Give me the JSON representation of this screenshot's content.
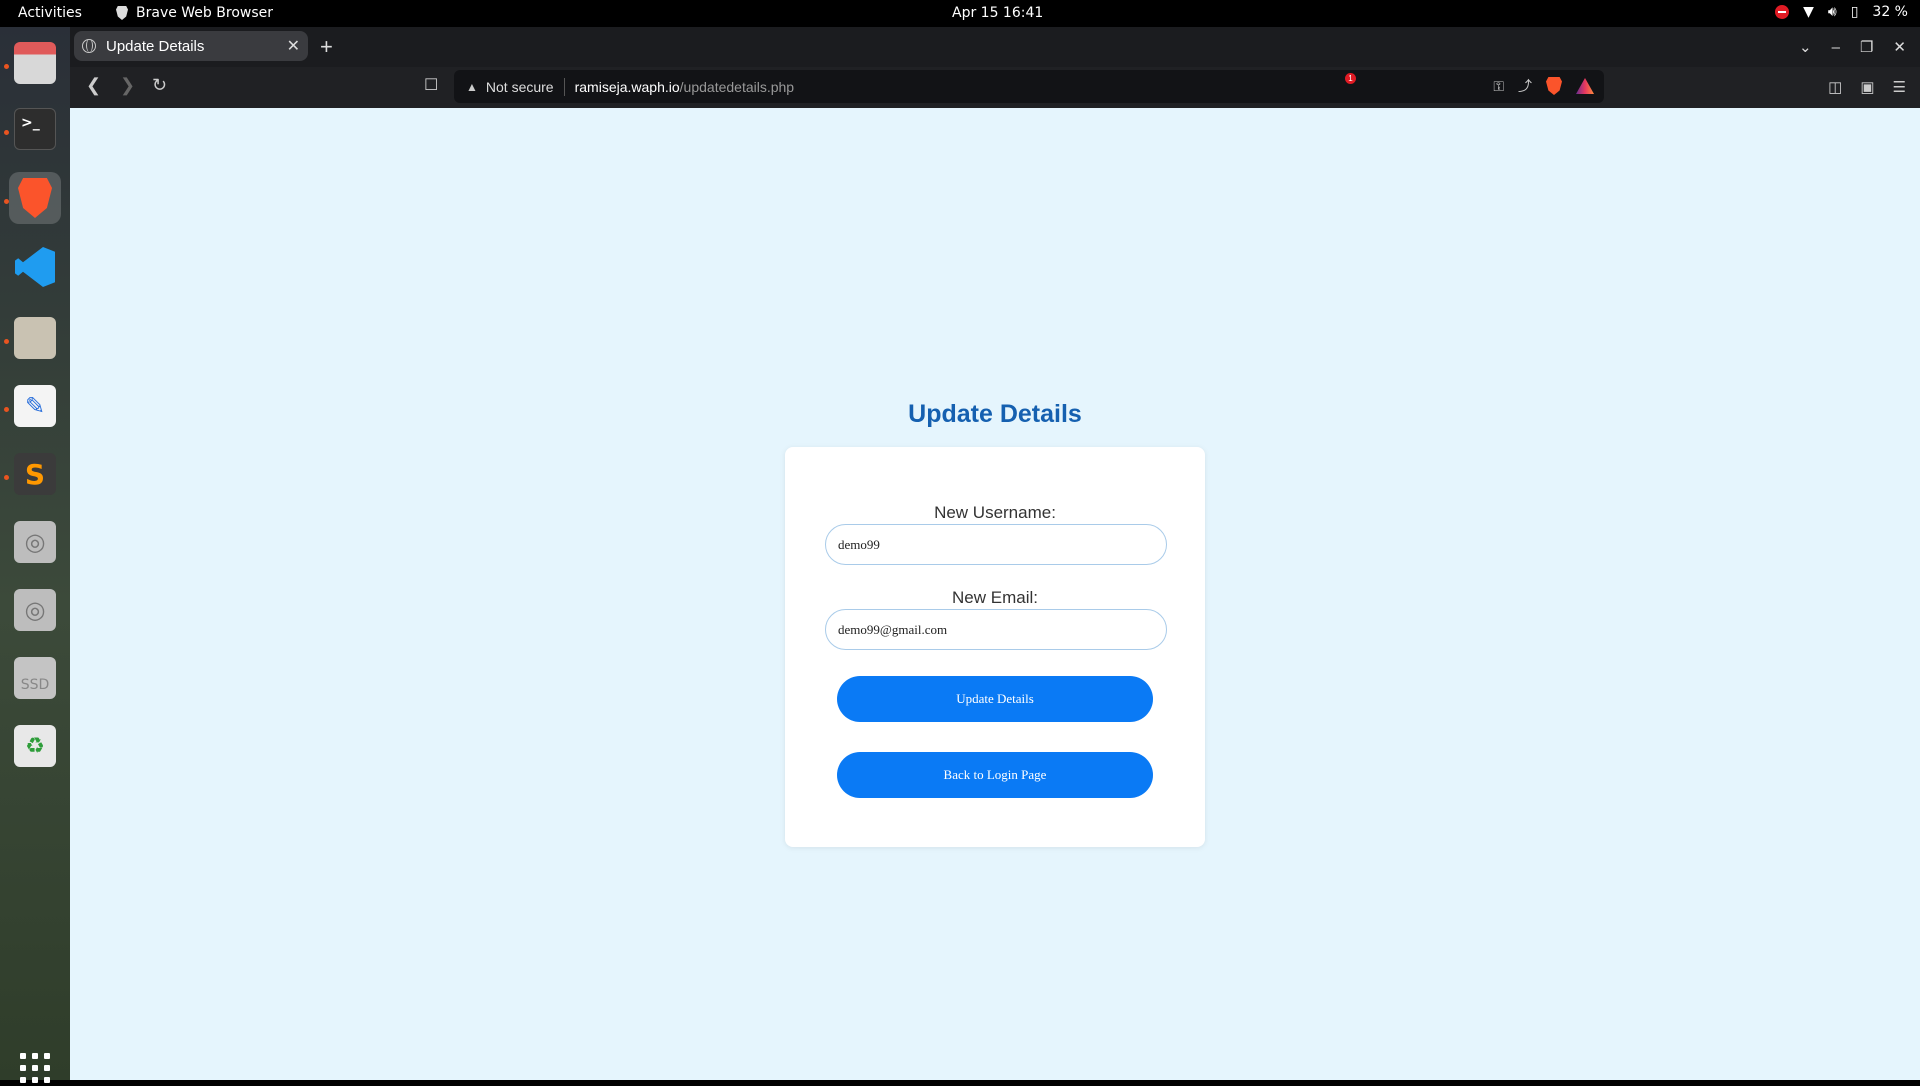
{
  "system": {
    "activities": "Activities",
    "app_name": "Brave Web Browser",
    "clock": "Apr 15  16:41",
    "battery": "32 %"
  },
  "browser": {
    "tab_title": "Update Details",
    "url_warning": "Not secure",
    "url_host": "ramiseja.waph.io",
    "url_path": "/updatedetails.php",
    "rewards_badge": "1"
  },
  "form": {
    "heading": "Update Details",
    "username_label": "New Username:",
    "username_value": "demo99",
    "email_label": "New Email:",
    "email_value": "demo99@gmail.com",
    "update_button": "Update Details",
    "back_button": "Back to Login Page"
  },
  "colors": {
    "page_background": "#e5f5fd",
    "heading": "#1560b0",
    "button": "#0a7af5"
  }
}
